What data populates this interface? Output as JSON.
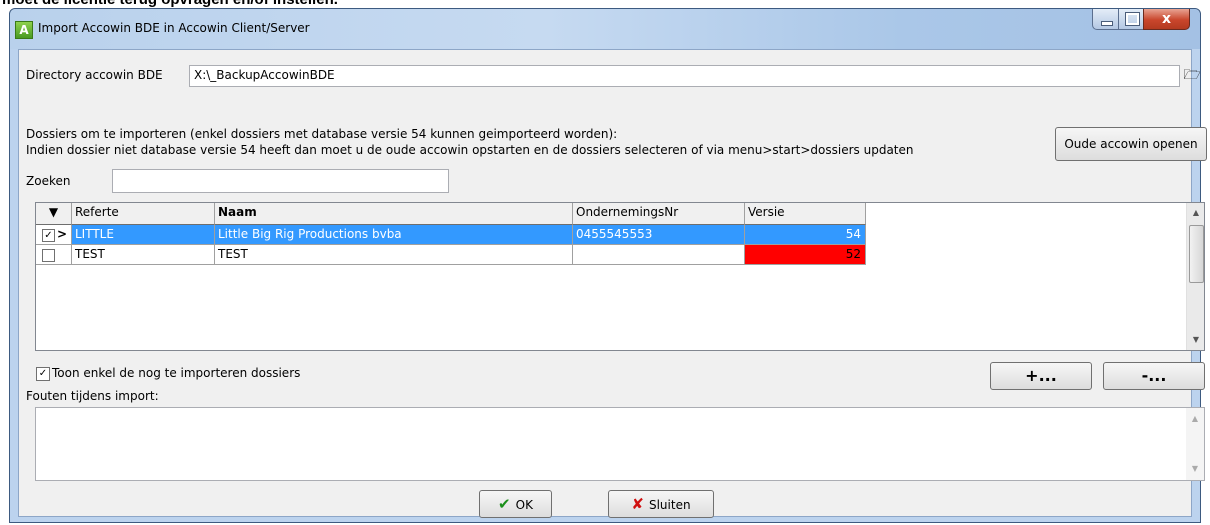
{
  "doc_header_text": "moet de licentie terug opvragen en/of instellen.",
  "window": {
    "title": "Import Accowin BDE in Accowin Client/Server",
    "controls": {
      "close_glyph": "x"
    }
  },
  "dir": {
    "label": "Directory accowin BDE",
    "value": "X:\\_BackupAccowinBDE"
  },
  "info": {
    "line1": "Dossiers om te importeren (enkel dossiers met database versie 54 kunnen geimporteerd worden):",
    "line2": "Indien dossier niet database versie 54 heeft dan moet u de oude accowin opstarten en de dossiers  selecteren of via menu>start>dossiers updaten"
  },
  "oude_button": "Oude accowin openen",
  "search": {
    "label": "Zoeken",
    "value": ""
  },
  "table": {
    "columns": [
      "Referte",
      "Naam",
      "OndernemingsNr",
      "Versie"
    ],
    "rows": [
      {
        "checked": true,
        "indicator": ">",
        "referte": "LITTLE",
        "naam": "Little Big Rig Productions bvba",
        "nr": "0455545553",
        "versie": "54",
        "versie_color": "#3399ff"
      },
      {
        "checked": false,
        "indicator": "",
        "referte": "TEST",
        "naam": "TEST",
        "nr": "",
        "versie": "52",
        "versie_color": "#ff0000"
      }
    ]
  },
  "toon_checkbox": {
    "label": "Toon enkel de nog te importeren dossiers",
    "checked": true
  },
  "plus_button": "+...",
  "minus_button": "-...",
  "fouten": {
    "label": "Fouten tijdens import:",
    "value": ""
  },
  "ok_button": "OK",
  "sluiten_button": "Sluiten",
  "colors": {
    "selection": "#3399ff",
    "error_version": "#ff0000",
    "window_frame": "#bcd3ee"
  }
}
